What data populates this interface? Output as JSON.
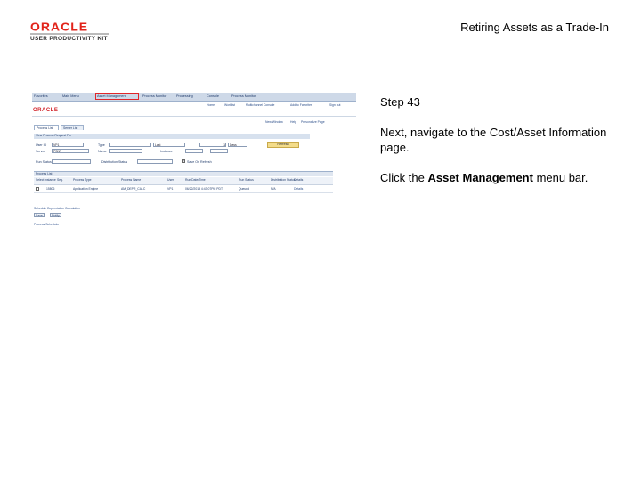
{
  "logo": {
    "wordmark": "ORACLE",
    "subtitle": "USER PRODUCTIVITY KIT"
  },
  "slide_title": "Retiring Assets as a Trade-In",
  "step": {
    "number": "Step 43",
    "instruction": "Next, navigate to the Cost/Asset Information page.",
    "action_prefix": "Click the ",
    "action_target": "Asset Management",
    "action_suffix": " menu bar."
  },
  "screenshot": {
    "menubar": [
      "Favorites",
      "Main Menu",
      "Asset Management",
      "Process Monitor",
      "Processing",
      "Console",
      "Process Monitor"
    ],
    "nav2": [
      "Home",
      "Worklist",
      "Multichannel Console",
      "Add to Favorites",
      "Sign out"
    ],
    "toplinks": [
      "New Window",
      "Help",
      "Personalize Page"
    ],
    "tabs": [
      "Process List",
      "Server List"
    ],
    "section": "View Process Request For",
    "labels": {
      "user_id": "User ID",
      "type": "Type",
      "last": "Last",
      "server": "Server",
      "name": "Name",
      "instance": "Instance",
      "run_status": "Run Status",
      "dist_status": "Distribution Status",
      "save_on_refresh": "Save On Refresh"
    },
    "values": {
      "user_id": "VP1",
      "type": "",
      "last_num": "1",
      "last_unit": "Days",
      "server": "PSNT",
      "instance": ""
    },
    "refresh": "Refresh",
    "grid_title": "Process List",
    "columns": [
      "Select",
      "Instance",
      "Seq.",
      "Process Type",
      "Process Name",
      "User",
      "Run Date/Time",
      "Run Status",
      "Distribution Status",
      "Details"
    ],
    "row": [
      "",
      "15806",
      "",
      "Application Engine",
      "AM_DEPR_CALC",
      "VP1",
      "06/22/2013 4:43:07PM PDT",
      "Queued",
      "N/A",
      "Details"
    ],
    "footer": [
      "Schedule Depreciation Calculation",
      "Save",
      "Notify",
      "Process Scheduler"
    ]
  }
}
